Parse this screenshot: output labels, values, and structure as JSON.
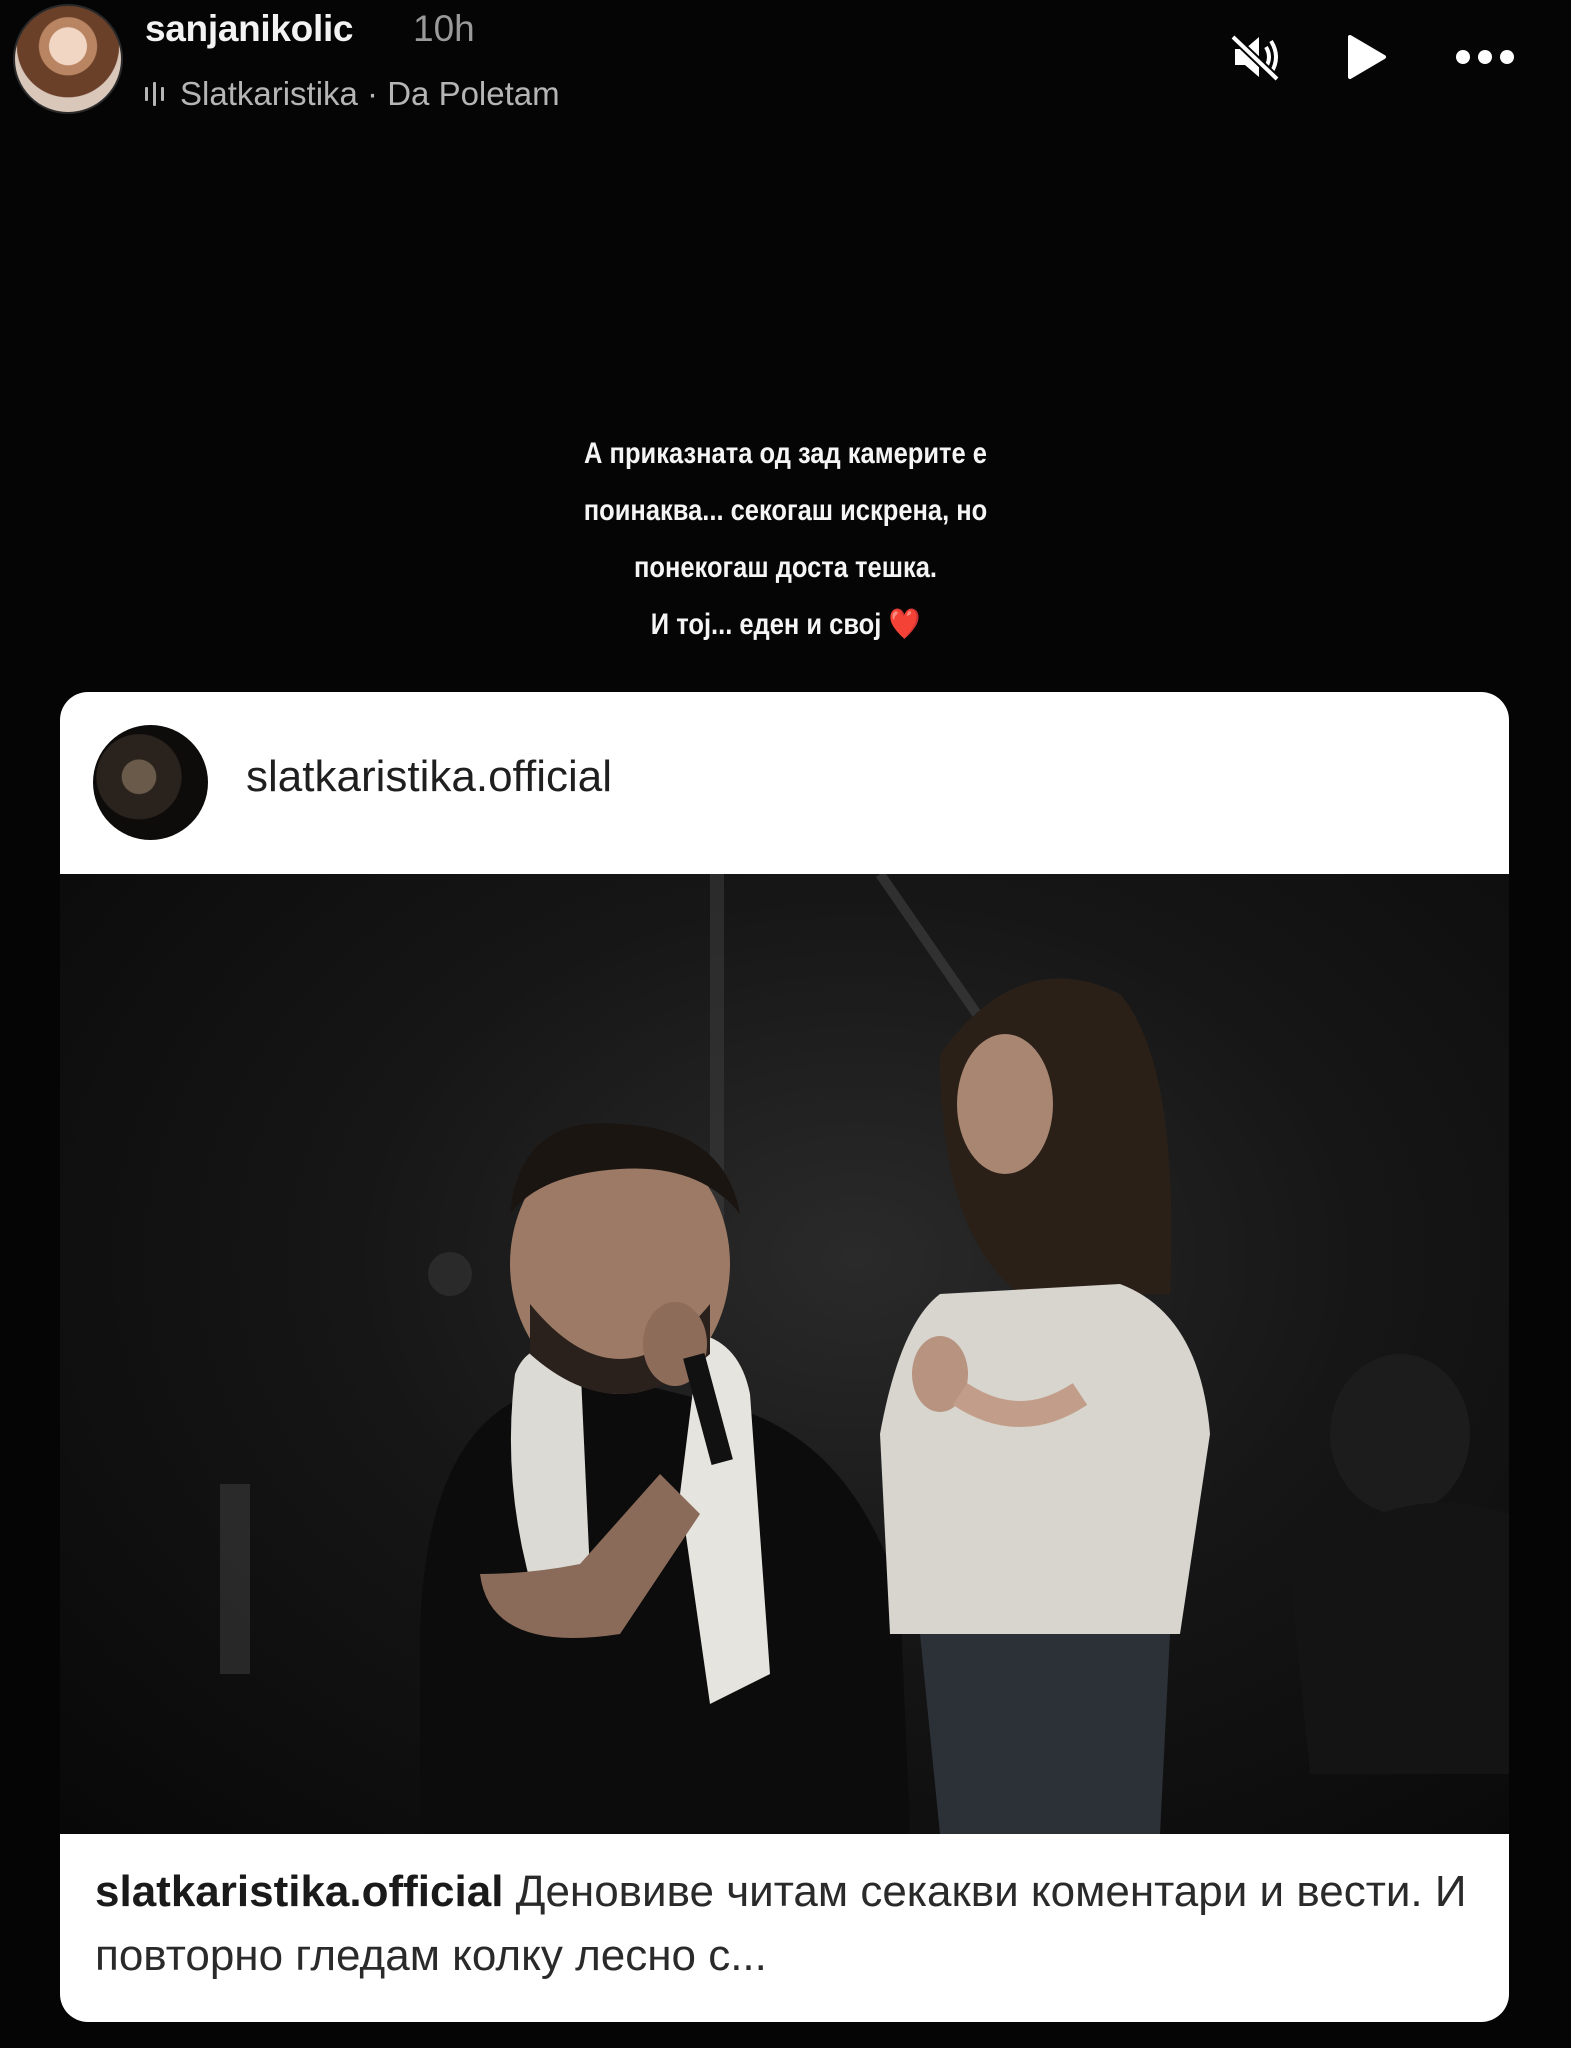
{
  "story": {
    "username": "sanjanikolic",
    "time": "10h",
    "music": "Slatkaristika · Da Poletam"
  },
  "controls": {
    "mute_icon": "speaker-muted-icon",
    "play_icon": "play-icon",
    "more_icon": "more-horizontal-icon"
  },
  "caption": {
    "lines": [
      "А приказната од зад камерите е",
      "поинаква... секогаш искрена, но",
      "понекогаш доста тешка.",
      "И тој... еден и свој"
    ],
    "emoji": "❤️"
  },
  "shared_post": {
    "username": "slatkaristika.official",
    "caption_user": "slatkaristika.official",
    "caption_text": " Деновиве читам секакви коментари и вести. И повторно гледам колку лесно с..."
  },
  "colors": {
    "background": "#050505",
    "heart": "#e0363d",
    "card": "#ffffff"
  }
}
